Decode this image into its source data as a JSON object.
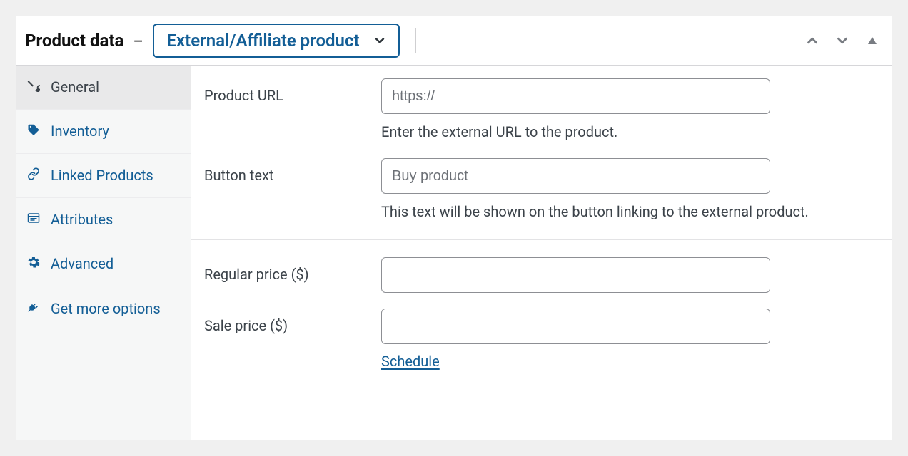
{
  "header": {
    "title": "Product data",
    "dash": "—",
    "product_type": "External/Affiliate product"
  },
  "tabs": {
    "general": "General",
    "inventory": "Inventory",
    "linked": "Linked Products",
    "attributes": "Attributes",
    "advanced": "Advanced",
    "get_more": "Get more options"
  },
  "form": {
    "product_url": {
      "label": "Product URL",
      "placeholder": "https://",
      "value": "",
      "help": "Enter the external URL to the product."
    },
    "button_text": {
      "label": "Button text",
      "placeholder": "Buy product",
      "value": "",
      "help": "This text will be shown on the button linking to the external product."
    },
    "regular_price": {
      "label": "Regular price ($)",
      "placeholder": "",
      "value": ""
    },
    "sale_price": {
      "label": "Sale price ($)",
      "placeholder": "",
      "value": "",
      "schedule": "Schedule"
    }
  },
  "colors": {
    "link": "#135e96",
    "border": "#8d8f94",
    "panel_border": "#cfcfd1"
  }
}
